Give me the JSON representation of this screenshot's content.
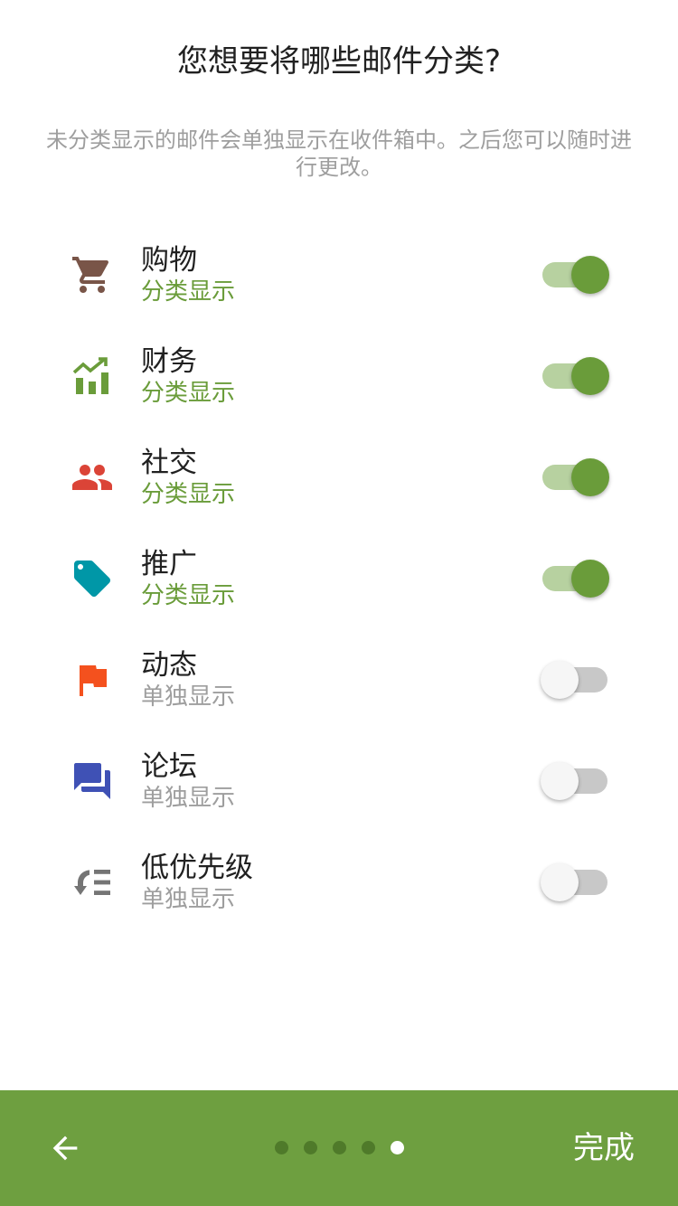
{
  "header": {
    "title": "您想要将哪些邮件分类?",
    "subtitle": "未分类显示的邮件会单独显示在收件箱中。之后您可以随时进行更改。"
  },
  "categories": [
    {
      "name": "购物",
      "status": "分类显示",
      "enabled": true,
      "icon": "shopping-cart-icon",
      "color": "#795548"
    },
    {
      "name": "财务",
      "status": "分类显示",
      "enabled": true,
      "icon": "finance-chart-icon",
      "color": "#6a9c3a"
    },
    {
      "name": "社交",
      "status": "分类显示",
      "enabled": true,
      "icon": "people-icon",
      "color": "#db4437"
    },
    {
      "name": "推广",
      "status": "分类显示",
      "enabled": true,
      "icon": "tag-icon",
      "color": "#0097a7"
    },
    {
      "name": "动态",
      "status": "单独显示",
      "enabled": false,
      "icon": "flag-icon",
      "color": "#f4511e"
    },
    {
      "name": "论坛",
      "status": "单独显示",
      "enabled": false,
      "icon": "forum-icon",
      "color": "#3f51b5"
    },
    {
      "name": "低优先级",
      "status": "单独显示",
      "enabled": false,
      "icon": "low-priority-icon",
      "color": "#757575"
    }
  ],
  "footer": {
    "back_icon": "arrow-left-icon",
    "done_label": "完成",
    "page_count": 5,
    "current_page": 5,
    "background_color": "#6e9f40"
  },
  "colors": {
    "accent": "#6a9c3a",
    "switch_track_on": "#b7d1a0",
    "switch_track_off": "#c8c8c8"
  }
}
